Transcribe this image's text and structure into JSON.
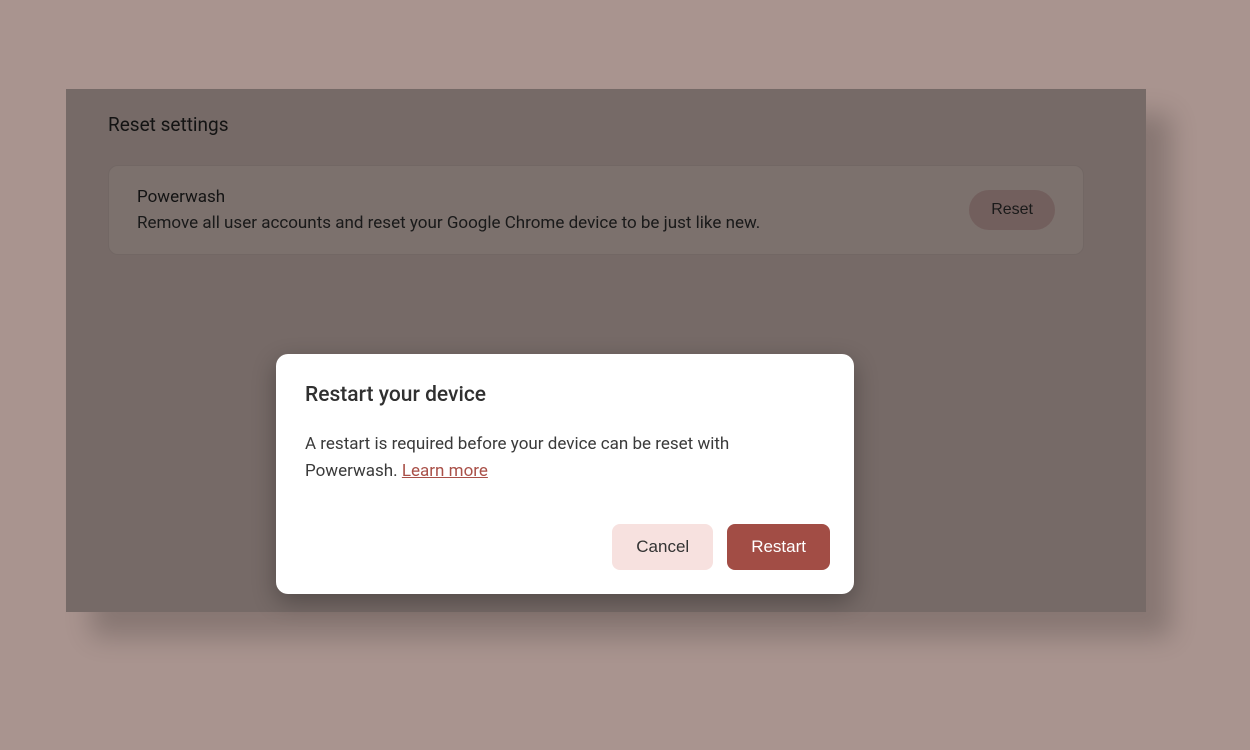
{
  "settings": {
    "section_title": "Reset settings",
    "card": {
      "title": "Powerwash",
      "description": "Remove all user accounts and reset your Google Chrome device to be just like new.",
      "button_label": "Reset"
    }
  },
  "modal": {
    "title": "Restart your device",
    "body_text": "A restart is required before your device can be reset with Powerwash. ",
    "learn_more_label": "Learn more",
    "cancel_label": "Cancel",
    "restart_label": "Restart"
  },
  "colors": {
    "background": "#a9948f",
    "panel": "#beaba6",
    "accent": "#a24d45",
    "accent_light": "#f7e1df"
  }
}
